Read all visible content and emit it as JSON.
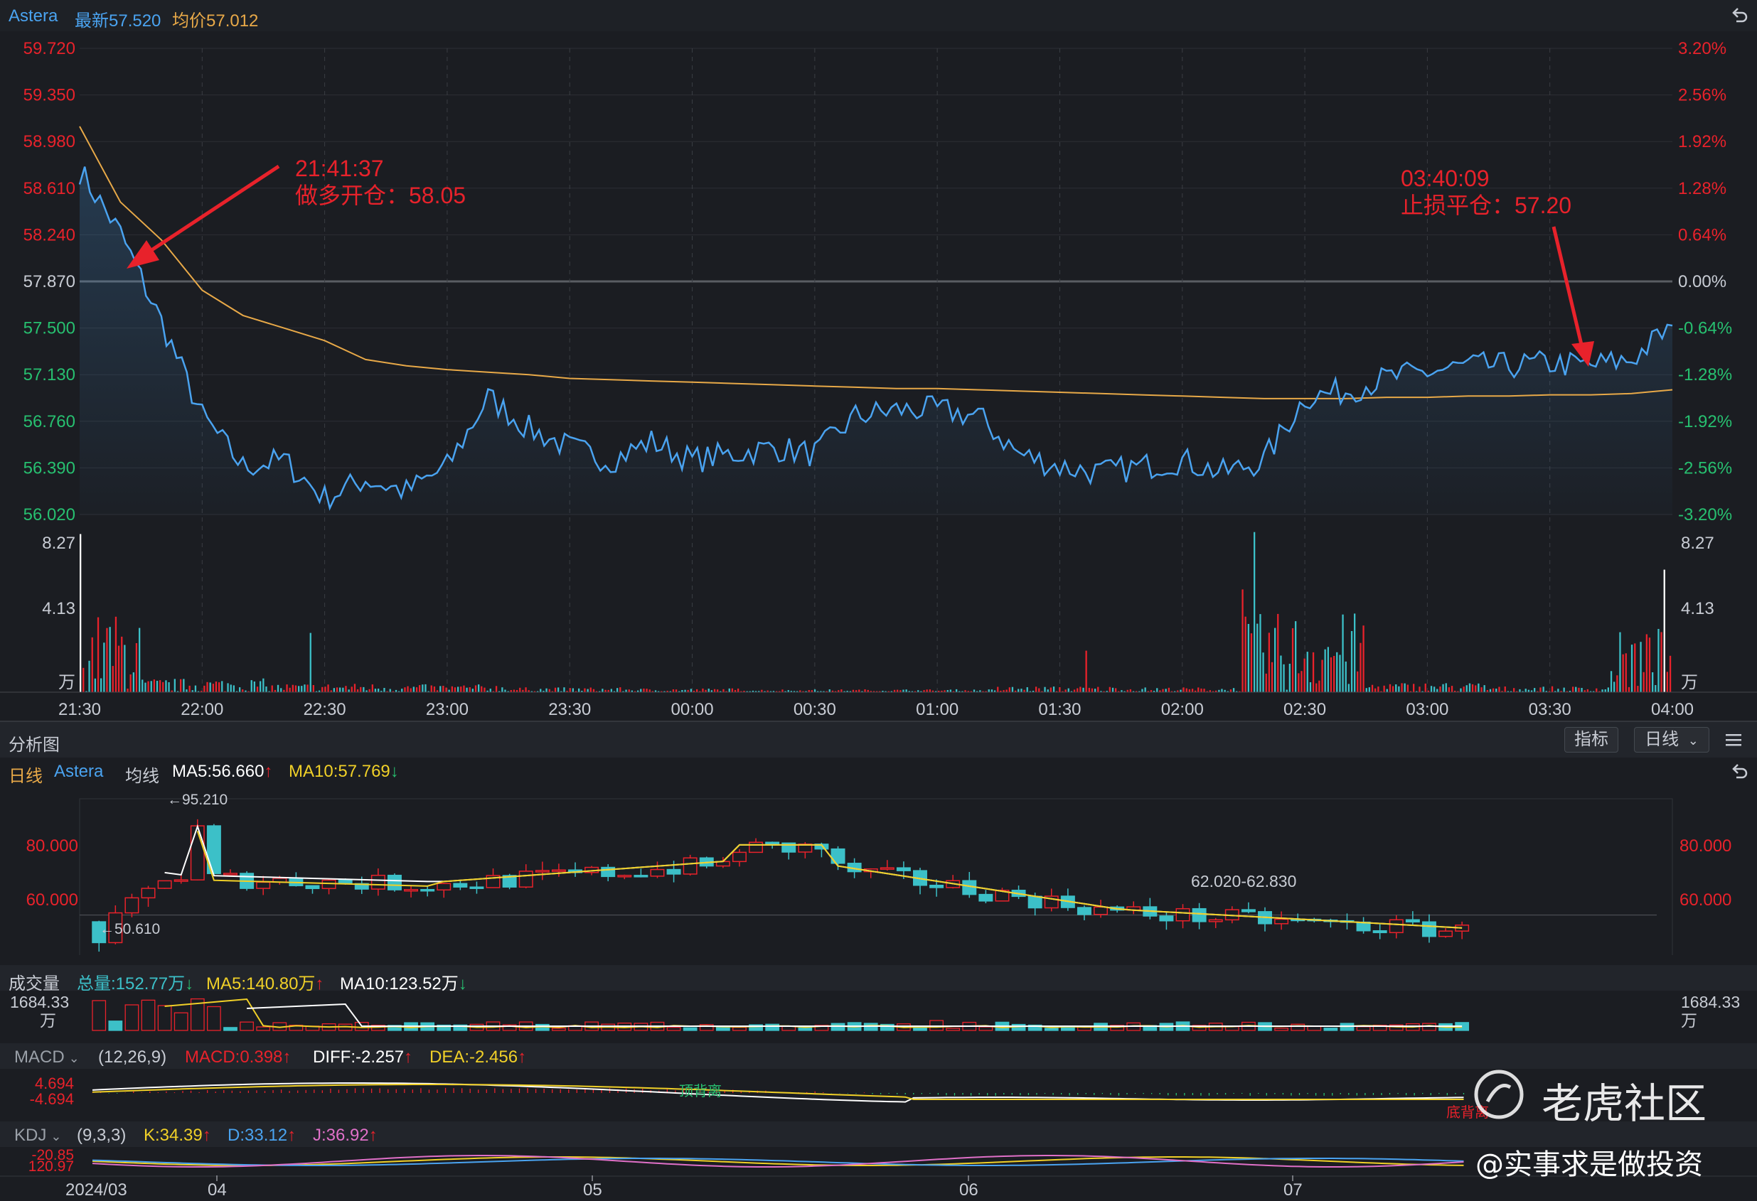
{
  "header": {
    "symbol": "Astera",
    "last_label": "最新57.520",
    "avg_label": "均价57.012",
    "back_icon": "undo-arrow-icon"
  },
  "intraday": {
    "price_ticks": [
      "59.720",
      "59.350",
      "58.980",
      "58.610",
      "58.240",
      "57.870",
      "57.500",
      "57.130",
      "56.760",
      "56.390",
      "56.020"
    ],
    "pct_ticks": [
      "3.20%",
      "2.56%",
      "1.92%",
      "1.28%",
      "0.64%",
      "0.00%",
      "-0.64%",
      "-1.28%",
      "-1.92%",
      "-2.56%",
      "-3.20%"
    ],
    "vol_ticks": [
      "8.27",
      "4.13",
      "万"
    ],
    "time_ticks": [
      "21:30",
      "22:00",
      "22:30",
      "23:00",
      "23:30",
      "00:00",
      "00:30",
      "01:00",
      "01:30",
      "02:00",
      "02:30",
      "03:00",
      "03:30",
      "04:00"
    ],
    "annotations": [
      {
        "time": "21:41:37",
        "text": "做多开仓：58.05"
      },
      {
        "time": "03:40:09",
        "text": "止损平仓：57.20"
      }
    ]
  },
  "analysis_bar": {
    "title": "分析图",
    "indicator_btn": "指标",
    "period_btn": "日线",
    "menu_icon": "hamburger-menu-icon"
  },
  "daily": {
    "legend": {
      "period": "日线",
      "symbol": "Astera",
      "avg": "均线",
      "ma5": "MA5:56.660",
      "ma10": "MA10:57.769"
    },
    "y_ticks": [
      "80.000",
      "60.000"
    ],
    "high_label": "←95.210",
    "low_label": "←50.610",
    "range_label": "62.020-62.830"
  },
  "volume_panel": {
    "title": "成交量",
    "total": "总量:152.77万",
    "ma5": "MA5:140.80万",
    "ma10": "MA10:123.52万",
    "tick": "1684.33",
    "unit": "万"
  },
  "macd_panel": {
    "title": "MACD",
    "params": "(12,26,9)",
    "macd": "MACD:0.398",
    "diff": "DIFF:-2.257",
    "dea": "DEA:-2.456",
    "tick_top": "4.694",
    "tick_bottom": "-4.694",
    "label_top": "顶背离",
    "label_bottom": "底背离"
  },
  "kdj_panel": {
    "title": "KDJ",
    "params": "(9,3,3)",
    "k": "K:34.39",
    "d": "D:33.12",
    "j": "J:36.92",
    "tick_top": "-20.85",
    "tick_bottom": "120.97"
  },
  "bottom_axis": {
    "labels": [
      "2024/03",
      "04",
      "05",
      "06",
      "07"
    ]
  },
  "watermark": {
    "brand": "老虎社区",
    "author": "@实事求是做投资"
  },
  "chart_data": [
    {
      "type": "line",
      "title": "",
      "x": [
        "21:30",
        "21:40",
        "21:50",
        "22:00",
        "22:10",
        "22:20",
        "22:30",
        "22:40",
        "22:50",
        "23:00",
        "23:10",
        "23:20",
        "23:30",
        "23:40",
        "23:50",
        "00:00",
        "00:10",
        "00:20",
        "00:30",
        "00:40",
        "00:50",
        "01:00",
        "01:10",
        "01:20",
        "01:30",
        "01:40",
        "01:50",
        "02:00",
        "02:10",
        "02:20",
        "02:30",
        "02:40",
        "02:50",
        "03:00",
        "03:10",
        "03:20",
        "03:30",
        "03:40",
        "03:50",
        "04:00"
      ],
      "series": [
        {
          "name": "最新",
          "values": [
            58.75,
            58.25,
            57.55,
            56.8,
            56.4,
            56.45,
            56.15,
            56.3,
            56.2,
            56.4,
            56.95,
            56.7,
            56.55,
            56.45,
            56.6,
            56.45,
            56.5,
            56.55,
            56.5,
            56.8,
            56.85,
            56.85,
            56.8,
            56.5,
            56.4,
            56.35,
            56.4,
            56.45,
            56.35,
            56.45,
            56.95,
            57.0,
            57.1,
            57.15,
            57.2,
            57.2,
            57.22,
            57.2,
            57.25,
            57.52
          ]
        },
        {
          "name": "均价",
          "values": [
            59.1,
            58.5,
            58.2,
            57.8,
            57.6,
            57.5,
            57.4,
            57.25,
            57.2,
            57.17,
            57.15,
            57.13,
            57.1,
            57.09,
            57.08,
            57.07,
            57.06,
            57.05,
            57.04,
            57.03,
            57.02,
            57.02,
            57.01,
            57.0,
            56.99,
            56.98,
            56.97,
            56.96,
            56.95,
            56.94,
            56.94,
            56.94,
            56.95,
            56.95,
            56.96,
            56.96,
            56.97,
            56.97,
            56.98,
            57.01
          ]
        }
      ],
      "ylim": [
        56.02,
        59.72
      ],
      "xlabel": "",
      "ylabel": ""
    },
    {
      "type": "bar",
      "title": "",
      "categories": [
        "21:30",
        "22:00",
        "22:30",
        "23:00",
        "23:30",
        "00:00",
        "00:30",
        "01:00",
        "01:30",
        "02:00",
        "02:30",
        "03:00",
        "03:30",
        "04:00"
      ],
      "values": [
        8.0,
        1.4,
        0.9,
        0.8,
        0.5,
        0.4,
        0.3,
        0.3,
        0.6,
        0.5,
        8.1,
        1.0,
        0.6,
        6.2
      ],
      "ylim": [
        0,
        8.27
      ],
      "unit": "万"
    },
    {
      "type": "line",
      "title": "",
      "x": [
        "2024/03",
        "04",
        "05",
        "06",
        "07"
      ],
      "series": [
        {
          "name": "MA5",
          "values": [
            75,
            72,
            80,
            63,
            57
          ]
        },
        {
          "name": "MA10",
          "values": [
            74,
            73,
            78,
            64,
            57
          ]
        }
      ],
      "ylim": [
        45,
        100
      ]
    }
  ]
}
